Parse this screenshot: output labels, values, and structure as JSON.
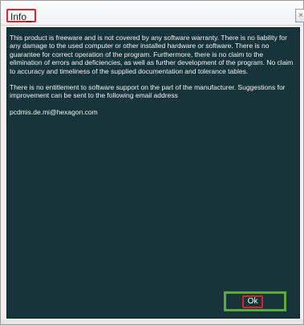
{
  "window": {
    "title": "Info_",
    "close_label": "×"
  },
  "message": {
    "paragraphs": [
      "This product is freeware and is not covered by any software warranty. There is no liability for any damage to the used computer or other installed hardware or software. There is no guarantee for correct operation of the program. Furthermore, there is no claim to the elimination of errors and deficiencies, as well as further development of the program. No claim to accuracy and timeliness of the supplied documentation and tolerance tables.",
      "There is no entitlement to software support on the part of the manufacturer. Suggestions for improvement can be sent to the following email address",
      "pcdmis.de.mi@hexagon.com"
    ]
  },
  "buttons": {
    "ok_label": "Ok"
  },
  "colors": {
    "content_background": "#17343a",
    "text": "#f2f4f4",
    "title_highlight": "#d9242b",
    "ok_highlight": "#5aaa3c"
  }
}
